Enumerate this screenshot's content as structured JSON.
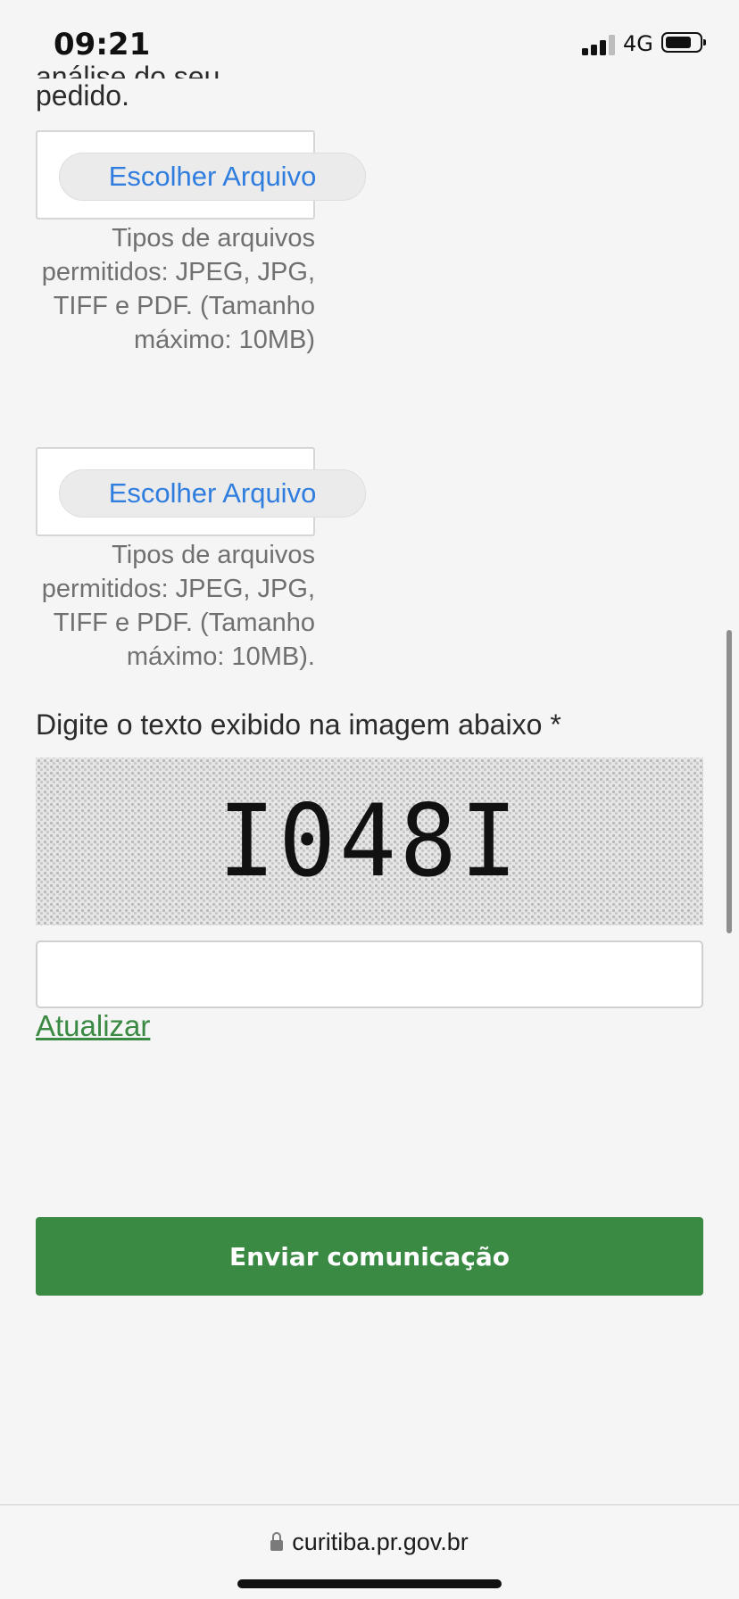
{
  "status_bar": {
    "time": "09:21",
    "network": "4G"
  },
  "form": {
    "partial_text": "análise do seu",
    "partial_text_end": "pedido.",
    "file_uploads": [
      {
        "button_label": "Escolher Arquivo",
        "help_text": "Tipos de arquivos permitidos: JPEG, JPG, TIFF e PDF. (Tamanho máximo: 10MB)"
      },
      {
        "button_label": "Escolher Arquivo",
        "help_text": "Tipos de arquivos permitidos: JPEG, JPG, TIFF e PDF. (Tamanho máximo: 10MB)."
      }
    ],
    "captcha": {
      "label": "Digite o texto exibido na imagem abaixo *",
      "image_text": "I048I",
      "input_value": "",
      "refresh_label": "Atualizar"
    },
    "submit_label": "Enviar comunicação"
  },
  "browser": {
    "address": "curitiba.pr.gov.br"
  },
  "colors": {
    "accent_green": "#3a8a44",
    "link_blue": "#2f7ddf",
    "background": "#f4f5f4"
  },
  "icons": [
    "signal-icon",
    "battery-icon",
    "lock-icon"
  ]
}
